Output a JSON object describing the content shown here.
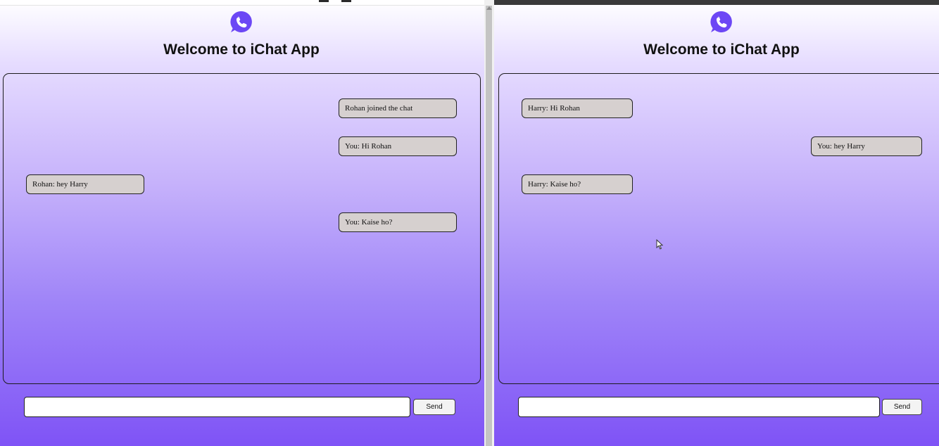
{
  "app": {
    "title": "Welcome to iChat App",
    "logo_icon": "whatsapp-phone-icon",
    "accent_color": "#6c47f5",
    "bubble_color": "#d6d0cf"
  },
  "left_window": {
    "messages": [
      {
        "text": "Rohan joined the chat",
        "side": "right"
      },
      {
        "text": "You: Hi Rohan",
        "side": "right"
      },
      {
        "text": "Rohan: hey Harry",
        "side": "left"
      },
      {
        "text": "You: Kaise ho?",
        "side": "right"
      }
    ],
    "input": {
      "value": "",
      "placeholder": ""
    },
    "send_label": "Send"
  },
  "right_window": {
    "messages": [
      {
        "text": "Harry: Hi Rohan",
        "side": "left"
      },
      {
        "text": "You: hey Harry",
        "side": "right"
      },
      {
        "text": "Harry: Kaise ho?",
        "side": "left"
      }
    ],
    "input": {
      "value": "",
      "placeholder": ""
    },
    "send_label": "Send"
  }
}
